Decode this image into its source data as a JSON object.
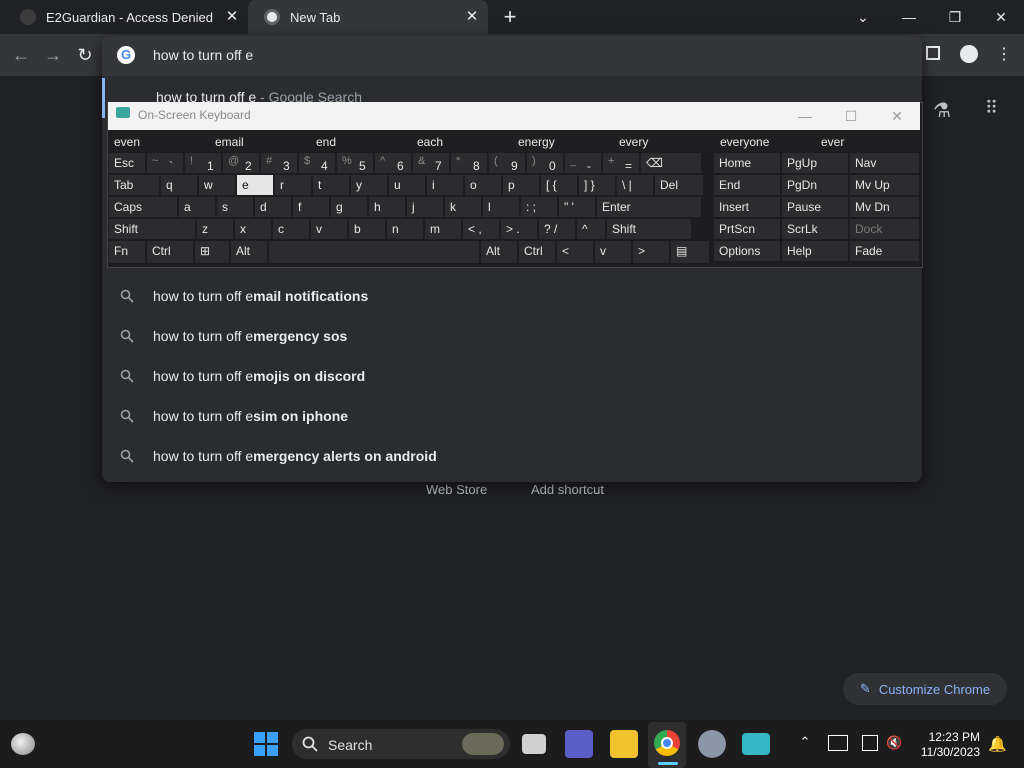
{
  "tabs": [
    {
      "title": "E2Guardian - Access Denied",
      "close": "✕"
    },
    {
      "title": "New Tab",
      "close": "✕"
    }
  ],
  "new_tab_symbol": "+",
  "window_controls": {
    "tab_search": "⌄",
    "minimize": "—",
    "restore": "❐",
    "close": "✕"
  },
  "omnibox": {
    "input_text": "how to turn off e",
    "first_suggestion": {
      "text": "how to turn off e",
      "suffix": " - Google Search"
    },
    "suggestions": [
      {
        "prefix": "how to turn off e",
        "bold": "mail notifications"
      },
      {
        "prefix": "how to turn off e",
        "bold": "mergency sos"
      },
      {
        "prefix": "how to turn off e",
        "bold": "mojis on discord"
      },
      {
        "prefix": "how to turn off e",
        "bold": "sim on iphone"
      },
      {
        "prefix": "how to turn off e",
        "bold": "mergency alerts on android"
      }
    ]
  },
  "page": {
    "shortcuts": [
      "Web Store",
      "Add shortcut"
    ],
    "customize_label": "Customize Chrome"
  },
  "osk": {
    "title": "On-Screen Keyboard",
    "predictions": [
      "even",
      "email",
      "end",
      "each",
      "energy",
      "every",
      "everyone",
      "ever"
    ],
    "row1": [
      {
        "label": "Esc"
      },
      {
        "sh": "~",
        "lo": "`"
      },
      {
        "sh": "!",
        "lo": "1"
      },
      {
        "sh": "@",
        "lo": "2"
      },
      {
        "sh": "#",
        "lo": "3"
      },
      {
        "sh": "$",
        "lo": "4"
      },
      {
        "sh": "%",
        "lo": "5"
      },
      {
        "sh": "^",
        "lo": "6"
      },
      {
        "sh": "&",
        "lo": "7"
      },
      {
        "sh": "*",
        "lo": "8"
      },
      {
        "sh": "(",
        "lo": "9"
      },
      {
        "sh": ")",
        "lo": "0"
      },
      {
        "sh": "_",
        "lo": "-"
      },
      {
        "sh": "+",
        "lo": "="
      },
      {
        "label": "⌫"
      }
    ],
    "row2": [
      "Tab",
      "q",
      "w",
      "e",
      "r",
      "t",
      "y",
      "u",
      "i",
      "o",
      "p",
      "[ {",
      "] }",
      "\\ |",
      "Del"
    ],
    "row3": [
      "Caps",
      "a",
      "s",
      "d",
      "f",
      "g",
      "h",
      "j",
      "k",
      "l",
      ": ;",
      "\" '",
      "Enter"
    ],
    "row4": [
      "Shift",
      "z",
      "x",
      "c",
      "v",
      "b",
      "n",
      "m",
      "< ,",
      "> .",
      "? /",
      "^",
      "Shift"
    ],
    "row5": [
      "Fn",
      "Ctrl",
      "⊞",
      "Alt",
      "",
      "Alt",
      "Ctrl",
      "<",
      "v",
      ">",
      "▤"
    ],
    "nav": [
      [
        "Home",
        "PgUp",
        "Nav"
      ],
      [
        "End",
        "PgDn",
        "Mv Up"
      ],
      [
        "Insert",
        "Pause",
        "Mv Dn"
      ],
      [
        "PrtScn",
        "ScrLk",
        "Dock"
      ],
      [
        "Options",
        "Help",
        "Fade"
      ]
    ]
  },
  "taskbar": {
    "search_label": "Search",
    "time": "12:23 PM",
    "date": "11/30/2023"
  }
}
